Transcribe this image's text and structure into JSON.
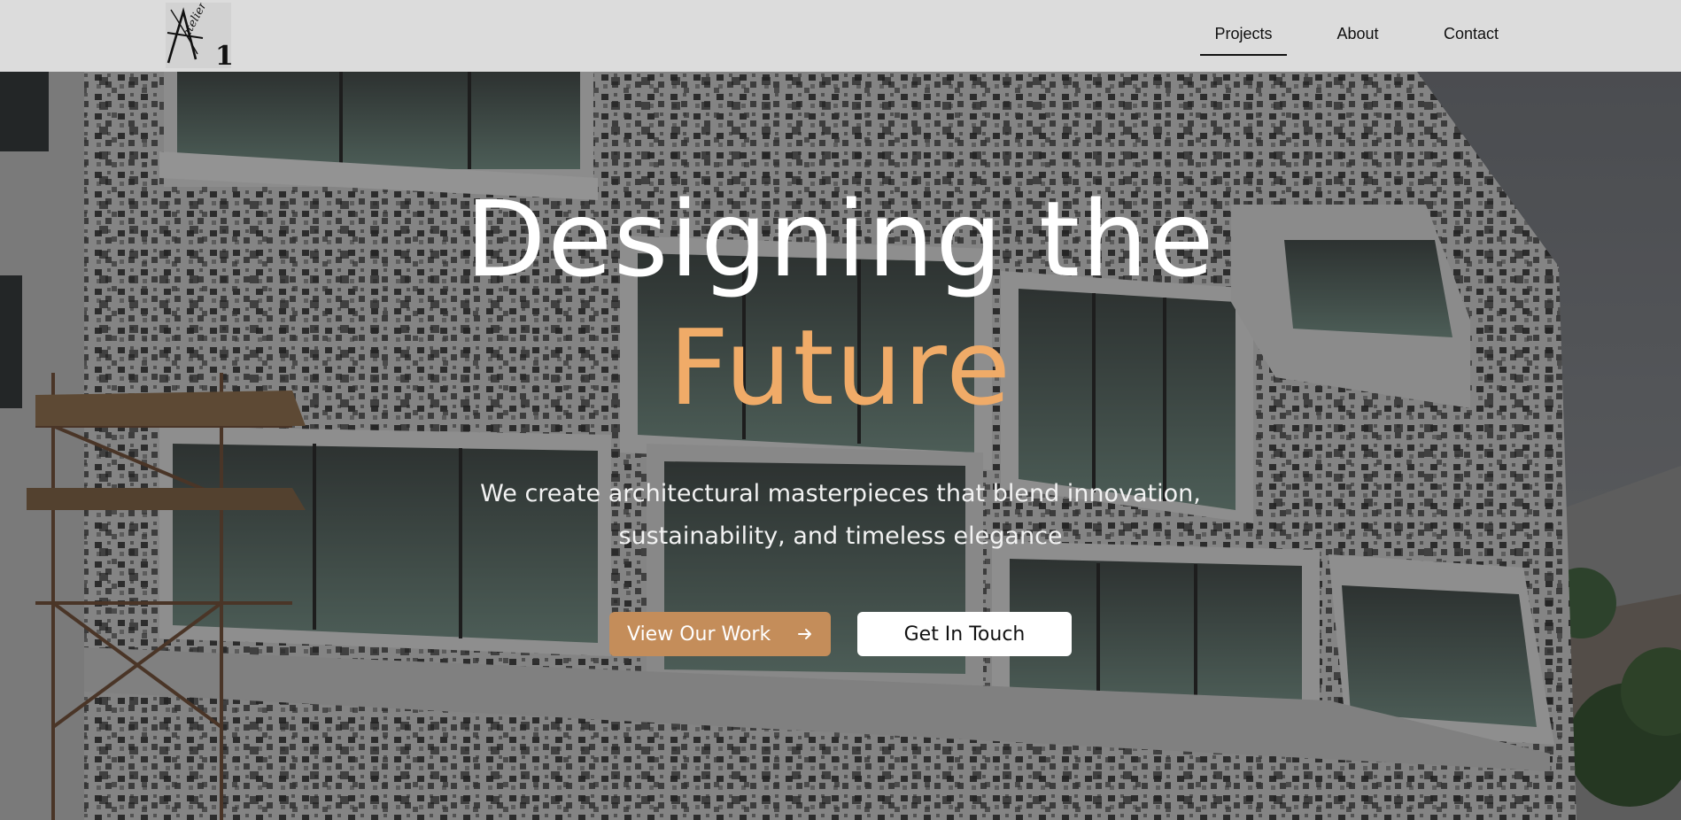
{
  "header": {
    "logo_text": "Atelier 1",
    "nav": [
      {
        "label": "Projects",
        "active": true
      },
      {
        "label": "About",
        "active": false
      },
      {
        "label": "Contact",
        "active": false
      }
    ]
  },
  "hero": {
    "title_line1": "Designing the",
    "title_line2": "Future",
    "subtitle_line1": "We create architectural masterpieces that blend innovation,",
    "subtitle_line2": "sustainability, and timeless elegance",
    "primary_button": "View Our Work",
    "primary_button_icon": "arrow-right-icon",
    "secondary_button": "Get In Touch",
    "background_image": "building facade under construction"
  },
  "colors": {
    "header_bg": "#dcdcdc",
    "accent": "#f0ab68",
    "button_primary_bg": "#c48d5a",
    "button_secondary_bg": "#ffffff",
    "text_light": "#ffffff"
  }
}
